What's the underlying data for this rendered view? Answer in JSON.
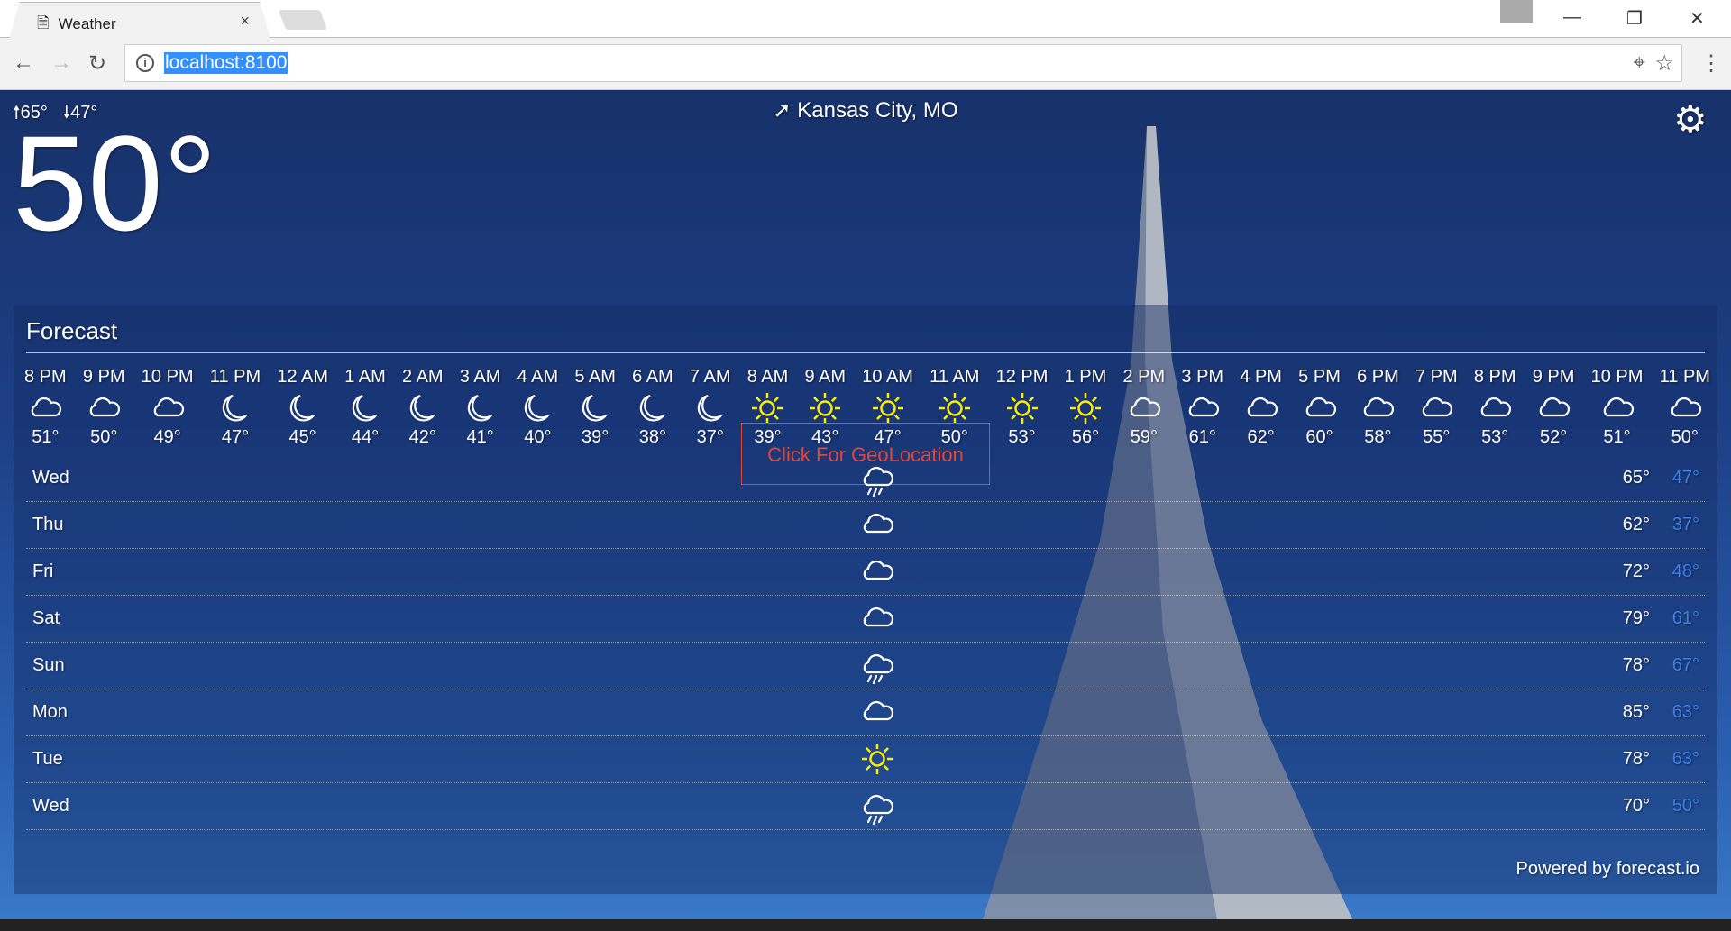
{
  "browser": {
    "tab_title": "Weather",
    "url": "localhost:8100"
  },
  "header": {
    "high": "65°",
    "low": "47°",
    "current_temp": "50°",
    "location": "Kansas City, MO"
  },
  "forecast": {
    "title": "Forecast",
    "geo_button": "Click For GeoLocation",
    "hourly": [
      {
        "time": "8 PM",
        "icon": "cloudy",
        "temp": "51°"
      },
      {
        "time": "9 PM",
        "icon": "cloudy",
        "temp": "50°"
      },
      {
        "time": "10 PM",
        "icon": "cloudy",
        "temp": "49°"
      },
      {
        "time": "11 PM",
        "icon": "moon",
        "temp": "47°"
      },
      {
        "time": "12 AM",
        "icon": "moon",
        "temp": "45°"
      },
      {
        "time": "1 AM",
        "icon": "moon",
        "temp": "44°"
      },
      {
        "time": "2 AM",
        "icon": "moon",
        "temp": "42°"
      },
      {
        "time": "3 AM",
        "icon": "moon",
        "temp": "41°"
      },
      {
        "time": "4 AM",
        "icon": "moon",
        "temp": "40°"
      },
      {
        "time": "5 AM",
        "icon": "moon",
        "temp": "39°"
      },
      {
        "time": "6 AM",
        "icon": "moon",
        "temp": "38°"
      },
      {
        "time": "7 AM",
        "icon": "moon",
        "temp": "37°"
      },
      {
        "time": "8 AM",
        "icon": "sun",
        "temp": "39°"
      },
      {
        "time": "9 AM",
        "icon": "sun",
        "temp": "43°"
      },
      {
        "time": "10 AM",
        "icon": "sun",
        "temp": "47°"
      },
      {
        "time": "11 AM",
        "icon": "sun",
        "temp": "50°"
      },
      {
        "time": "12 PM",
        "icon": "sun",
        "temp": "53°"
      },
      {
        "time": "1 PM",
        "icon": "sun",
        "temp": "56°"
      },
      {
        "time": "2 PM",
        "icon": "cloudy",
        "temp": "59°"
      },
      {
        "time": "3 PM",
        "icon": "cloudy",
        "temp": "61°"
      },
      {
        "time": "4 PM",
        "icon": "cloudy",
        "temp": "62°"
      },
      {
        "time": "5 PM",
        "icon": "cloudy",
        "temp": "60°"
      },
      {
        "time": "6 PM",
        "icon": "cloudy",
        "temp": "58°"
      },
      {
        "time": "7 PM",
        "icon": "cloudy",
        "temp": "55°"
      },
      {
        "time": "8 PM",
        "icon": "cloudy",
        "temp": "53°"
      },
      {
        "time": "9 PM",
        "icon": "cloudy",
        "temp": "52°"
      },
      {
        "time": "10 PM",
        "icon": "cloudy",
        "temp": "51°"
      },
      {
        "time": "11 PM",
        "icon": "cloudy",
        "temp": "50°"
      }
    ],
    "daily": [
      {
        "day": "Wed",
        "icon": "rain",
        "high": "65°",
        "low": "47°"
      },
      {
        "day": "Thu",
        "icon": "cloudy",
        "high": "62°",
        "low": "37°"
      },
      {
        "day": "Fri",
        "icon": "cloudy",
        "high": "72°",
        "low": "48°"
      },
      {
        "day": "Sat",
        "icon": "cloudy",
        "high": "79°",
        "low": "61°"
      },
      {
        "day": "Sun",
        "icon": "rain",
        "high": "78°",
        "low": "67°"
      },
      {
        "day": "Mon",
        "icon": "cloudy",
        "high": "85°",
        "low": "63°"
      },
      {
        "day": "Tue",
        "icon": "sun",
        "high": "78°",
        "low": "63°"
      },
      {
        "day": "Wed",
        "icon": "rain",
        "high": "70°",
        "low": "50°"
      }
    ],
    "powered_prefix": "Powered by",
    "powered_link": "forecast.io"
  },
  "colors": {
    "low_temp": "#3d7ee8",
    "sun": "#ffee00",
    "geo_border": "#e0463a"
  }
}
